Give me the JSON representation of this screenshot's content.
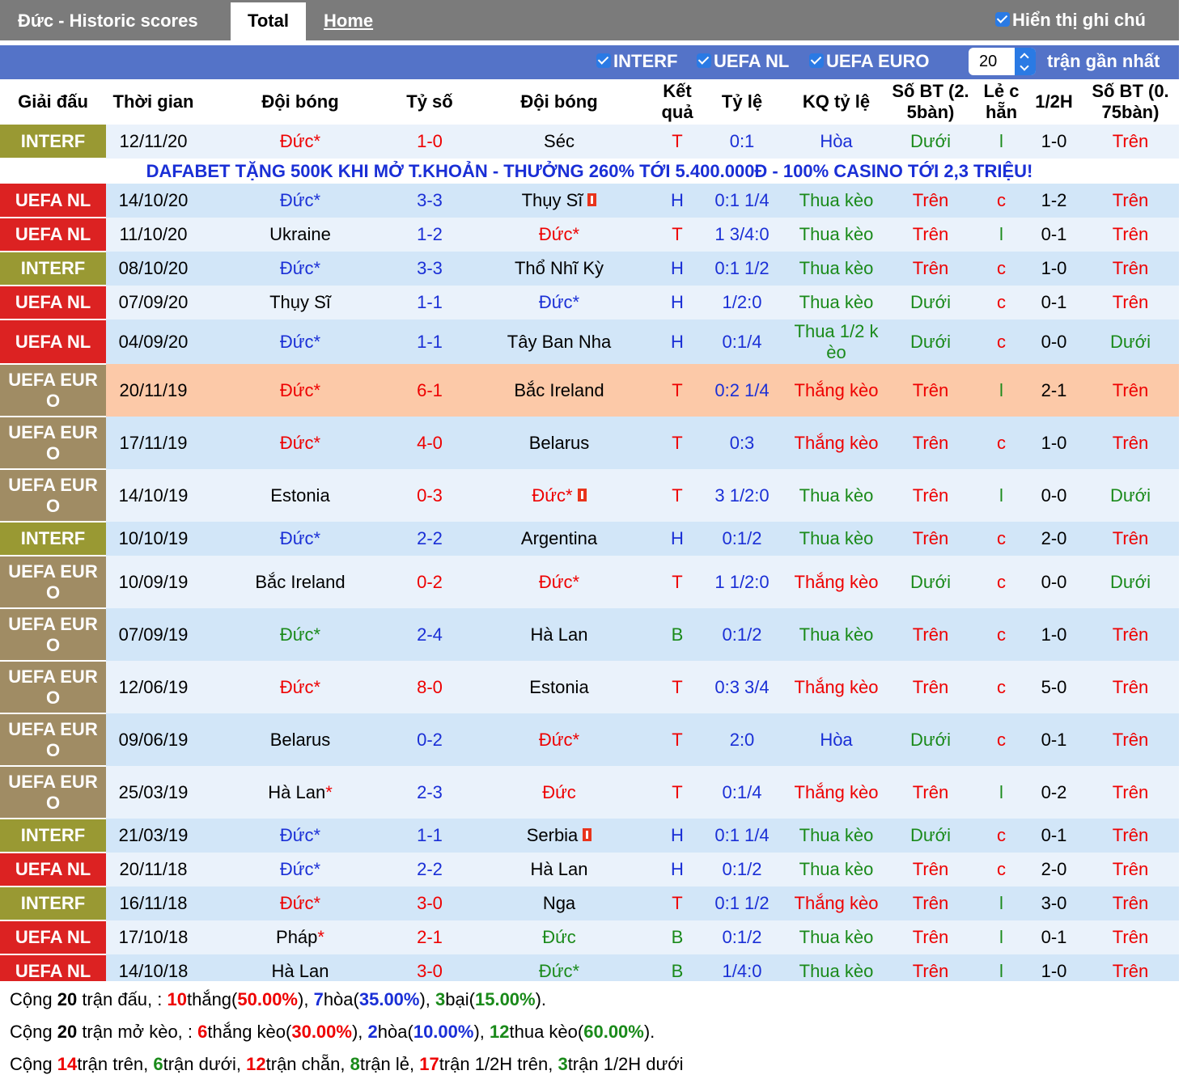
{
  "header": {
    "title": "Đức - Historic scores",
    "tab_total": "Total",
    "tab_home": "Home",
    "show_notes": "Hiển thị ghi chú"
  },
  "filters": {
    "items": [
      "INTERF",
      "UEFA NL",
      "UEFA EURO"
    ],
    "count_value": "20",
    "count_suffix": "trận gần nhất"
  },
  "columns": [
    "Giải đấu",
    "Thời gian",
    "Đội bóng",
    "Tỷ số",
    "Đội bóng",
    "Kết quả",
    "Tỷ lệ",
    "KQ tỷ lệ",
    "Số BT (2. 5bàn)",
    "Lẻ c hẵn",
    "1/2H",
    "Số BT (0. 75bàn)"
  ],
  "ad_text": "DAFABET TẶNG 500K KHI MỞ T.KHOẢN - THƯỞNG 260% TỚI 5.400.000Đ - 100% CASINO TỚI 2,3 TRIỆU!",
  "colors": {
    "interf": "#999933",
    "uefa_nl": "#dc2222",
    "uefa_euro": "#a08c64",
    "row_light": "#eaf2fb",
    "row_blue": "#d2e6f8",
    "row_highlight": "#fcc9a8"
  },
  "rows": [
    {
      "league": "INTERF",
      "date": "12/11/20",
      "home": "Đức*",
      "home_color": "red",
      "score": "1-0",
      "score_color": "red",
      "away": "Séc",
      "away_color": "black",
      "away_card": false,
      "home_card": false,
      "result": "T",
      "result_color": "red",
      "odds": "0:1",
      "odds_result": "Hòa",
      "odds_result_color": "blue",
      "ou": "Dưới",
      "ou_color": "green",
      "oe": "l",
      "oe_color": "green",
      "half": "1-0",
      "ou2": "Trên",
      "ou2_color": "red"
    },
    {
      "league": "UEFA NL",
      "date": "14/10/20",
      "home": "Đức*",
      "home_color": "blue",
      "score": "3-3",
      "score_color": "blue",
      "away": "Thụy Sĩ",
      "away_color": "black",
      "away_card": true,
      "home_card": false,
      "result": "H",
      "result_color": "blue",
      "odds": "0:1 1/4",
      "odds_result": "Thua kèo",
      "odds_result_color": "green",
      "ou": "Trên",
      "ou_color": "red",
      "oe": "c",
      "oe_color": "red",
      "half": "1-2",
      "ou2": "Trên",
      "ou2_color": "red"
    },
    {
      "league": "UEFA NL",
      "date": "11/10/20",
      "home": "Ukraine",
      "home_color": "black",
      "score": "1-2",
      "score_color": "blue",
      "away": "Đức*",
      "away_color": "red",
      "away_card": false,
      "home_card": false,
      "result": "T",
      "result_color": "red",
      "odds": "1 3/4:0",
      "odds_result": "Thua kèo",
      "odds_result_color": "green",
      "ou": "Trên",
      "ou_color": "red",
      "oe": "l",
      "oe_color": "green",
      "half": "0-1",
      "ou2": "Trên",
      "ou2_color": "red"
    },
    {
      "league": "INTERF",
      "date": "08/10/20",
      "home": "Đức*",
      "home_color": "blue",
      "score": "3-3",
      "score_color": "blue",
      "away": "Thổ Nhĩ Kỳ",
      "away_color": "black",
      "away_card": false,
      "home_card": false,
      "result": "H",
      "result_color": "blue",
      "odds": "0:1 1/2",
      "odds_result": "Thua kèo",
      "odds_result_color": "green",
      "ou": "Trên",
      "ou_color": "red",
      "oe": "c",
      "oe_color": "red",
      "half": "1-0",
      "ou2": "Trên",
      "ou2_color": "red"
    },
    {
      "league": "UEFA NL",
      "date": "07/09/20",
      "home": "Thụy Sĩ",
      "home_color": "black",
      "score": "1-1",
      "score_color": "blue",
      "away": "Đức*",
      "away_color": "blue",
      "away_card": false,
      "home_card": false,
      "result": "H",
      "result_color": "blue",
      "odds": "1/2:0",
      "odds_result": "Thua kèo",
      "odds_result_color": "green",
      "ou": "Dưới",
      "ou_color": "green",
      "oe": "c",
      "oe_color": "red",
      "half": "0-1",
      "ou2": "Trên",
      "ou2_color": "red"
    },
    {
      "league": "UEFA NL",
      "date": "04/09/20",
      "home": "Đức*",
      "home_color": "blue",
      "score": "1-1",
      "score_color": "blue",
      "away": "Tây Ban Nha",
      "away_color": "black",
      "away_card": false,
      "home_card": false,
      "result": "H",
      "result_color": "blue",
      "odds": "0:1/4",
      "odds_result": "Thua 1/2 k èo",
      "odds_result_color": "green",
      "ou": "Dưới",
      "ou_color": "green",
      "oe": "c",
      "oe_color": "red",
      "half": "0-0",
      "ou2": "Dưới",
      "ou2_color": "green"
    },
    {
      "league": "UEFA EUR O",
      "date": "20/11/19",
      "home": "Đức*",
      "home_color": "red",
      "score": "6-1",
      "score_color": "red",
      "away": "Bắc Ireland",
      "away_color": "black",
      "away_card": false,
      "home_card": false,
      "result": "T",
      "result_color": "red",
      "odds": "0:2 1/4",
      "odds_result": "Thắng kèo",
      "odds_result_color": "red",
      "ou": "Trên",
      "ou_color": "red",
      "oe": "l",
      "oe_color": "green",
      "half": "2-1",
      "ou2": "Trên",
      "ou2_color": "red",
      "highlight": true
    },
    {
      "league": "UEFA EUR O",
      "date": "17/11/19",
      "home": "Đức*",
      "home_color": "red",
      "score": "4-0",
      "score_color": "red",
      "away": "Belarus",
      "away_color": "black",
      "away_card": false,
      "home_card": false,
      "result": "T",
      "result_color": "red",
      "odds": "0:3",
      "odds_result": "Thắng kèo",
      "odds_result_color": "red",
      "ou": "Trên",
      "ou_color": "red",
      "oe": "c",
      "oe_color": "red",
      "half": "1-0",
      "ou2": "Trên",
      "ou2_color": "red"
    },
    {
      "league": "UEFA EUR O",
      "date": "14/10/19",
      "home": "Estonia",
      "home_color": "black",
      "score": "0-3",
      "score_color": "red",
      "away": "Đức*",
      "away_color": "red",
      "away_card": true,
      "home_card": false,
      "result": "T",
      "result_color": "red",
      "odds": "3 1/2:0",
      "odds_result": "Thua kèo",
      "odds_result_color": "green",
      "ou": "Trên",
      "ou_color": "red",
      "oe": "l",
      "oe_color": "green",
      "half": "0-0",
      "ou2": "Dưới",
      "ou2_color": "green"
    },
    {
      "league": "INTERF",
      "date": "10/10/19",
      "home": "Đức*",
      "home_color": "blue",
      "score": "2-2",
      "score_color": "blue",
      "away": "Argentina",
      "away_color": "black",
      "away_card": false,
      "home_card": false,
      "result": "H",
      "result_color": "blue",
      "odds": "0:1/2",
      "odds_result": "Thua kèo",
      "odds_result_color": "green",
      "ou": "Trên",
      "ou_color": "red",
      "oe": "c",
      "oe_color": "red",
      "half": "2-0",
      "ou2": "Trên",
      "ou2_color": "red"
    },
    {
      "league": "UEFA EUR O",
      "date": "10/09/19",
      "home": "Bắc Ireland",
      "home_color": "black",
      "score": "0-2",
      "score_color": "red",
      "away": "Đức*",
      "away_color": "red",
      "away_card": false,
      "home_card": false,
      "result": "T",
      "result_color": "red",
      "odds": "1 1/2:0",
      "odds_result": "Thắng kèo",
      "odds_result_color": "red",
      "ou": "Dưới",
      "ou_color": "green",
      "oe": "c",
      "oe_color": "red",
      "half": "0-0",
      "ou2": "Dưới",
      "ou2_color": "green"
    },
    {
      "league": "UEFA EUR O",
      "date": "07/09/19",
      "home": "Đức*",
      "home_color": "green",
      "score": "2-4",
      "score_color": "blue",
      "away": "Hà Lan",
      "away_color": "black",
      "away_card": false,
      "home_card": false,
      "result": "B",
      "result_color": "green",
      "odds": "0:1/2",
      "odds_result": "Thua kèo",
      "odds_result_color": "green",
      "ou": "Trên",
      "ou_color": "red",
      "oe": "c",
      "oe_color": "red",
      "half": "1-0",
      "ou2": "Trên",
      "ou2_color": "red"
    },
    {
      "league": "UEFA EUR O",
      "date": "12/06/19",
      "home": "Đức*",
      "home_color": "red",
      "score": "8-0",
      "score_color": "red",
      "away": "Estonia",
      "away_color": "black",
      "away_card": false,
      "home_card": false,
      "result": "T",
      "result_color": "red",
      "odds": "0:3 3/4",
      "odds_result": "Thắng kèo",
      "odds_result_color": "red",
      "ou": "Trên",
      "ou_color": "red",
      "oe": "c",
      "oe_color": "red",
      "half": "5-0",
      "ou2": "Trên",
      "ou2_color": "red"
    },
    {
      "league": "UEFA EUR O",
      "date": "09/06/19",
      "home": "Belarus",
      "home_color": "black",
      "score": "0-2",
      "score_color": "blue",
      "away": "Đức*",
      "away_color": "red",
      "away_card": false,
      "home_card": false,
      "result": "T",
      "result_color": "red",
      "odds": "2:0",
      "odds_result": "Hòa",
      "odds_result_color": "blue",
      "ou": "Dưới",
      "ou_color": "green",
      "oe": "c",
      "oe_color": "red",
      "half": "0-1",
      "ou2": "Trên",
      "ou2_color": "red"
    },
    {
      "league": "UEFA EUR O",
      "date": "25/03/19",
      "home": "Hà Lan",
      "home_color": "black",
      "home_star": true,
      "score": "2-3",
      "score_color": "blue",
      "away": "Đức",
      "away_color": "red",
      "away_card": false,
      "home_card": false,
      "result": "T",
      "result_color": "red",
      "odds": "0:1/4",
      "odds_result": "Thắng kèo",
      "odds_result_color": "red",
      "ou": "Trên",
      "ou_color": "red",
      "oe": "l",
      "oe_color": "green",
      "half": "0-2",
      "ou2": "Trên",
      "ou2_color": "red"
    },
    {
      "league": "INTERF",
      "date": "21/03/19",
      "home": "Đức*",
      "home_color": "blue",
      "score": "1-1",
      "score_color": "blue",
      "away": "Serbia",
      "away_color": "black",
      "away_card": true,
      "home_card": false,
      "result": "H",
      "result_color": "blue",
      "odds": "0:1 1/4",
      "odds_result": "Thua kèo",
      "odds_result_color": "green",
      "ou": "Dưới",
      "ou_color": "green",
      "oe": "c",
      "oe_color": "red",
      "half": "0-1",
      "ou2": "Trên",
      "ou2_color": "red"
    },
    {
      "league": "UEFA NL",
      "date": "20/11/18",
      "home": "Đức*",
      "home_color": "blue",
      "score": "2-2",
      "score_color": "blue",
      "away": "Hà Lan",
      "away_color": "black",
      "away_card": false,
      "home_card": false,
      "result": "H",
      "result_color": "blue",
      "odds": "0:1/2",
      "odds_result": "Thua kèo",
      "odds_result_color": "green",
      "ou": "Trên",
      "ou_color": "red",
      "oe": "c",
      "oe_color": "red",
      "half": "2-0",
      "ou2": "Trên",
      "ou2_color": "red"
    },
    {
      "league": "INTERF",
      "date": "16/11/18",
      "home": "Đức*",
      "home_color": "red",
      "score": "3-0",
      "score_color": "red",
      "away": "Nga",
      "away_color": "black",
      "away_card": false,
      "home_card": false,
      "result": "T",
      "result_color": "red",
      "odds": "0:1 1/2",
      "odds_result": "Thắng kèo",
      "odds_result_color": "red",
      "ou": "Trên",
      "ou_color": "red",
      "oe": "l",
      "oe_color": "green",
      "half": "3-0",
      "ou2": "Trên",
      "ou2_color": "red"
    },
    {
      "league": "UEFA NL",
      "date": "17/10/18",
      "home": "Pháp",
      "home_color": "black",
      "home_star": true,
      "score": "2-1",
      "score_color": "red",
      "away": "Đức",
      "away_color": "green",
      "away_card": false,
      "home_card": false,
      "result": "B",
      "result_color": "green",
      "odds": "0:1/2",
      "odds_result": "Thua kèo",
      "odds_result_color": "green",
      "ou": "Trên",
      "ou_color": "red",
      "oe": "l",
      "oe_color": "green",
      "half": "0-1",
      "ou2": "Trên",
      "ou2_color": "red"
    },
    {
      "league": "UEFA NL",
      "date": "14/10/18",
      "home": "Hà Lan",
      "home_color": "black",
      "score": "3-0",
      "score_color": "red",
      "away": "Đức*",
      "away_color": "green",
      "away_card": false,
      "home_card": false,
      "result": "B",
      "result_color": "green",
      "odds": "1/4:0",
      "odds_result": "Thua kèo",
      "odds_result_color": "green",
      "ou": "Trên",
      "ou_color": "red",
      "oe": "l",
      "oe_color": "green",
      "half": "1-0",
      "ou2": "Trên",
      "ou2_color": "red"
    }
  ],
  "summary": {
    "line1": [
      {
        "t": "Cộng "
      },
      {
        "t": "20",
        "s": "b"
      },
      {
        "t": " trận đấu, : "
      },
      {
        "t": "10",
        "s": "r"
      },
      {
        "t": "thắng("
      },
      {
        "t": "50.00%",
        "s": "r"
      },
      {
        "t": "), "
      },
      {
        "t": "7",
        "s": "bl"
      },
      {
        "t": "hòa("
      },
      {
        "t": "35.00%",
        "s": "bl"
      },
      {
        "t": "), "
      },
      {
        "t": "3",
        "s": "g"
      },
      {
        "t": "bại("
      },
      {
        "t": "15.00%",
        "s": "g"
      },
      {
        "t": ")."
      }
    ],
    "line2": [
      {
        "t": "Cộng "
      },
      {
        "t": "20",
        "s": "b"
      },
      {
        "t": " trận mở kèo, : "
      },
      {
        "t": "6",
        "s": "r"
      },
      {
        "t": "thắng kèo("
      },
      {
        "t": "30.00%",
        "s": "r"
      },
      {
        "t": "), "
      },
      {
        "t": "2",
        "s": "bl"
      },
      {
        "t": "hòa("
      },
      {
        "t": "10.00%",
        "s": "bl"
      },
      {
        "t": "), "
      },
      {
        "t": "12",
        "s": "g"
      },
      {
        "t": "thua kèo("
      },
      {
        "t": "60.00%",
        "s": "g"
      },
      {
        "t": ")."
      }
    ],
    "line3": [
      {
        "t": "Cộng "
      },
      {
        "t": "14",
        "s": "r"
      },
      {
        "t": "trận trên, "
      },
      {
        "t": "6",
        "s": "g"
      },
      {
        "t": "trận dưới, "
      },
      {
        "t": "12",
        "s": "r"
      },
      {
        "t": "trận chẵn, "
      },
      {
        "t": "8",
        "s": "g"
      },
      {
        "t": "trận lẻ, "
      },
      {
        "t": "17",
        "s": "r"
      },
      {
        "t": "trận 1/2H trên, "
      },
      {
        "t": "3",
        "s": "g"
      },
      {
        "t": "trận 1/2H dưới"
      }
    ]
  }
}
